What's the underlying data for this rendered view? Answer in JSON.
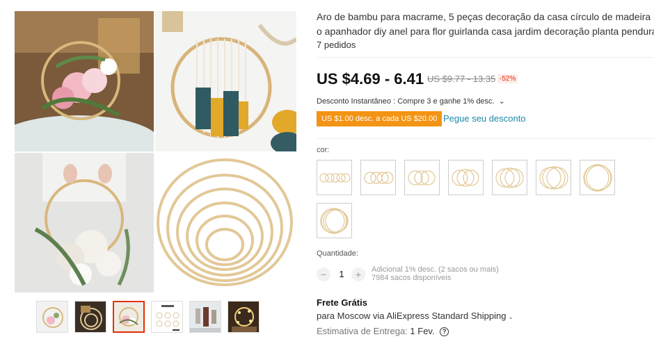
{
  "product": {
    "title_line1": "Aro de bambu para macrame, 5 peças decoração da casa círculo de madeira redon",
    "title_line2": "o apanhador diy anel para flor guirlanda casa jardim decoração planta pendurado",
    "orders": "7 pedidos"
  },
  "pricing": {
    "price": "US $4.69 - 6.41",
    "old_price": "US $9.77 - 13.35",
    "discount": "-52%",
    "instant": "Desconto Instantâneo : Compre 3 e ganhe 1% desc.",
    "instant_chevron": "⌄",
    "coupon": "US $1.00 desc. a cada US $20.00",
    "coupon_link": "Pegue seu desconto"
  },
  "variants": {
    "label": "cor:",
    "count": 8
  },
  "quantity": {
    "label": "Quantidade:",
    "minus": "−",
    "plus": "+",
    "value": "1",
    "info1": "Adicional 1% desc. (2 sacos ou mais)",
    "info2": "7984 sacos disponíveis"
  },
  "shipping": {
    "title": "Frete Grátis",
    "line": "para Moscow via AliExpress Standard Shipping",
    "line_chevron": "⌄",
    "estimate_label": "Estimativa de Entrega:",
    "estimate_value": "1 Fev.",
    "help_icon": "?"
  },
  "gallery": {
    "thumbnails": [
      "flower-hoop",
      "hoops-night",
      "flower-wreath",
      "size-chart",
      "wall-hangings",
      "fairy-lights"
    ],
    "selected_index": 2
  },
  "colors": {
    "accent": "#e62e04",
    "coupon_bg": "#f39415",
    "link": "#1a88a8",
    "bamboo": "#e2c897"
  }
}
